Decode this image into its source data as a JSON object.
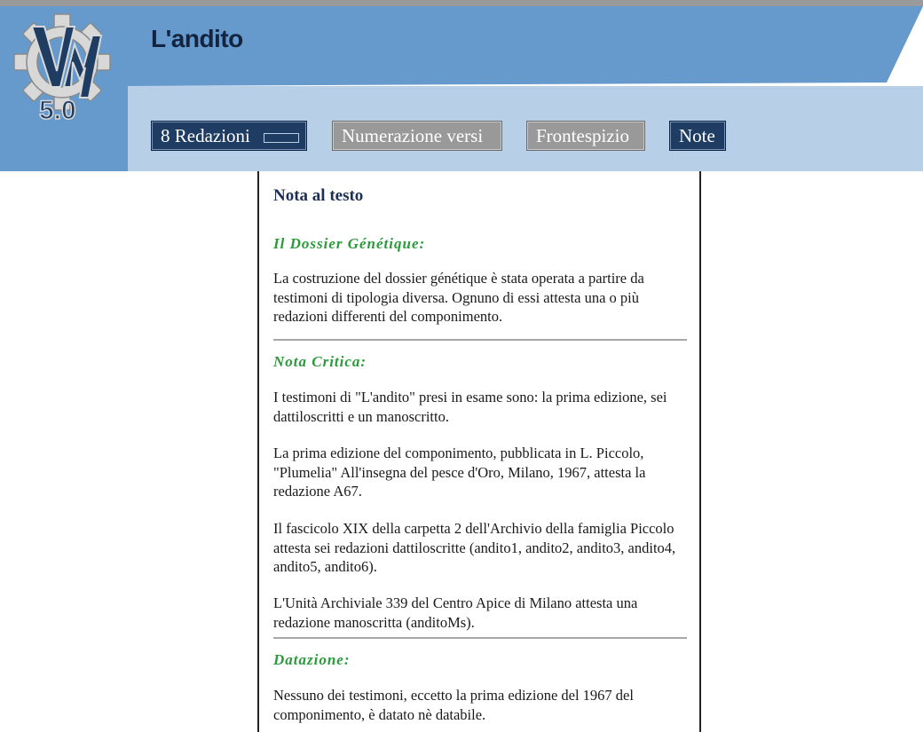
{
  "app": {
    "title": "L'andito",
    "logo_text": "5.0",
    "logo_letters": "VM"
  },
  "toolbar": {
    "redazioni_label": "8 Redazioni",
    "numerazione_label": "Numerazione versi",
    "frontespizio_label": "Frontespizio",
    "note_label": "Note"
  },
  "colors": {
    "header_blue": "#6699cc",
    "header_light": "#b8cfe8",
    "button_dark": "#1f3c62",
    "button_grey": "#999999",
    "section_green": "#2a9a3a",
    "title_navy": "#1c2f57"
  },
  "note": {
    "title": "Nota al testo",
    "sections": [
      {
        "heading": "Il Dossier Génétique:",
        "paragraphs": [
          "La costruzione del dossier génétique è stata operata a partire da testimoni di tipologia diversa. Ognuno di essi attesta una o più redazioni differenti del componimento."
        ]
      },
      {
        "heading": "Nota Critica:",
        "paragraphs": [
          "I testimoni di \"L'andito\" presi in esame sono: la prima edizione, sei dattiloscritti e un manoscritto.",
          "La prima edizione del componimento, pubblicata in L. Piccolo, \"Plumelia\" All'insegna del pesce d'Oro, Milano, 1967, attesta la redazione A67.",
          "Il fascicolo XIX della carpetta 2 dell'Archivio della famiglia Piccolo attesta sei redazioni dattiloscritte (andito1, andito2, andito3, andito4, andito5, andito6).",
          "L'Unità Archiviale 339 del Centro Apice di Milano attesta una redazione manoscritta (anditoMs)."
        ]
      },
      {
        "heading": "Datazione:",
        "paragraphs": [
          "Nessuno dei testimoni, eccetto la prima edizione del 1967 del componimento, è datato nè databile."
        ]
      }
    ]
  }
}
